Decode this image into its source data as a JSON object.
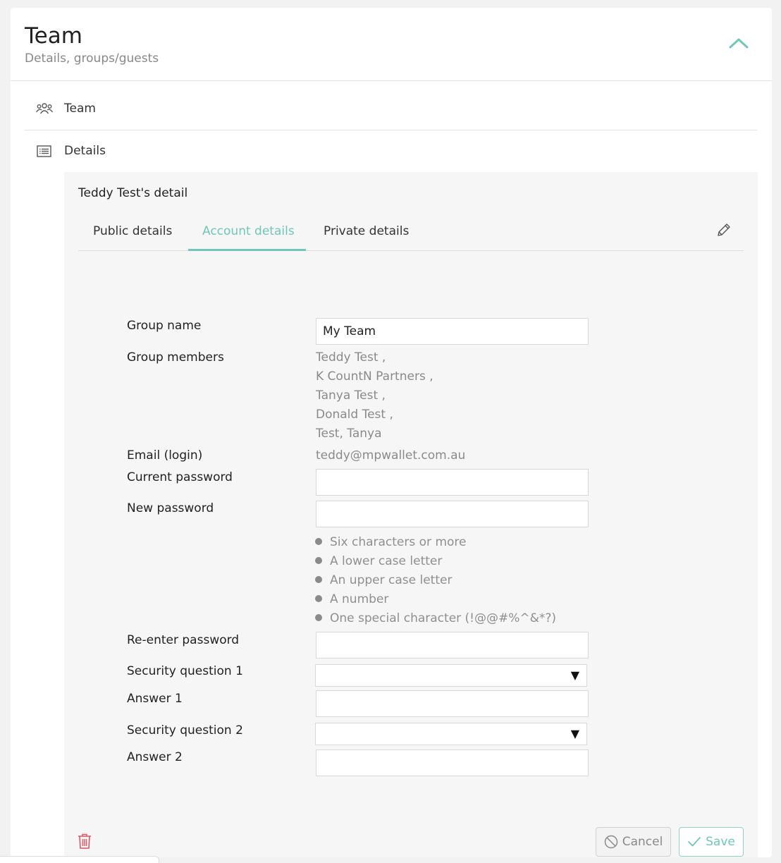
{
  "header": {
    "title": "Team",
    "subtitle": "Details, groups/guests"
  },
  "nav": {
    "team_label": "Team",
    "details_label": "Details"
  },
  "panel": {
    "title": "Teddy Test's detail",
    "tabs": [
      {
        "label": "Public details",
        "active": false
      },
      {
        "label": "Account details",
        "active": true
      },
      {
        "label": "Private details",
        "active": false
      }
    ]
  },
  "form": {
    "group_name_label": "Group name",
    "group_name_value": "My Team",
    "group_members_label": "Group members",
    "group_members": [
      "Teddy Test ,",
      "K CountN Partners ,",
      "Tanya Test ,",
      "Donald Test ,",
      "Test, Tanya"
    ],
    "email_label": "Email (login)",
    "email_value": "teddy@mpwallet.com.au",
    "current_password_label": "Current password",
    "new_password_label": "New password",
    "password_rules": [
      "Six characters or more",
      "A lower case letter",
      "An upper case letter",
      "A number",
      "One special character (!@@#%^&*?)"
    ],
    "reenter_password_label": "Re-enter password",
    "security_q1_label": "Security question 1",
    "answer1_label": "Answer 1",
    "security_q2_label": "Security question 2",
    "answer2_label": "Answer 2",
    "select_arrow": "▼"
  },
  "actions": {
    "cancel_label": "Cancel",
    "save_label": "Save"
  },
  "colors": {
    "accent": "#6fc7b8",
    "danger": "#e05560"
  },
  "icons": [
    "chevron-up-icon",
    "team-icon",
    "list-icon",
    "pencil-icon",
    "trash-icon",
    "ban-icon",
    "check-icon"
  ]
}
